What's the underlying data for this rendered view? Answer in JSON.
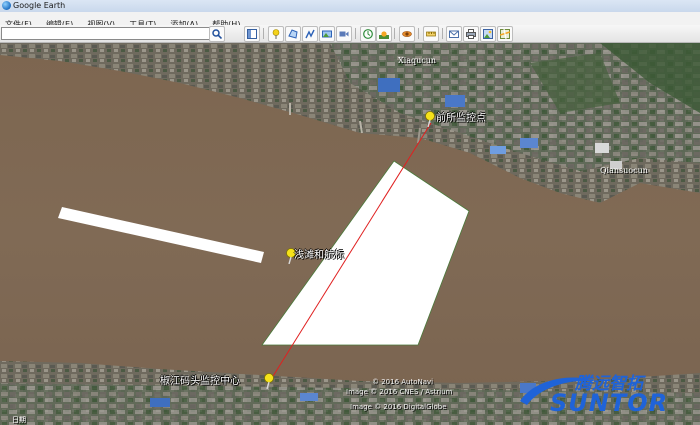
{
  "window": {
    "title": "Google Earth"
  },
  "menu": [
    "文件(F)",
    "编辑(E)",
    "视图(V)",
    "工具(T)",
    "添加(A)",
    "帮助(H)"
  ],
  "search": {
    "value": ""
  },
  "toolbar_icons": [
    "sidebar-toggle-icon",
    "placemark-icon",
    "polygon-icon",
    "path-icon",
    "image-overlay-icon",
    "record-tour-icon",
    "historical-imagery-icon",
    "sunlight-icon",
    "planet-icon",
    "ruler-icon",
    "email-icon",
    "print-icon",
    "save-image-icon",
    "maps-icon"
  ],
  "map": {
    "place_labels": [
      "Xiaqucun",
      "Qiansuocun"
    ],
    "placemarks": [
      "前所监控点",
      "浅滩和航标",
      "椒江码头监控中心"
    ],
    "credits": [
      "© 2016 AutoNavi",
      "Image © 2016 CNES / Astrium",
      "Image © 2016 DigitalGlobe"
    ],
    "status_left": "日期",
    "logo_cn": "腾远智拓",
    "logo_en": "SUNTOR"
  }
}
